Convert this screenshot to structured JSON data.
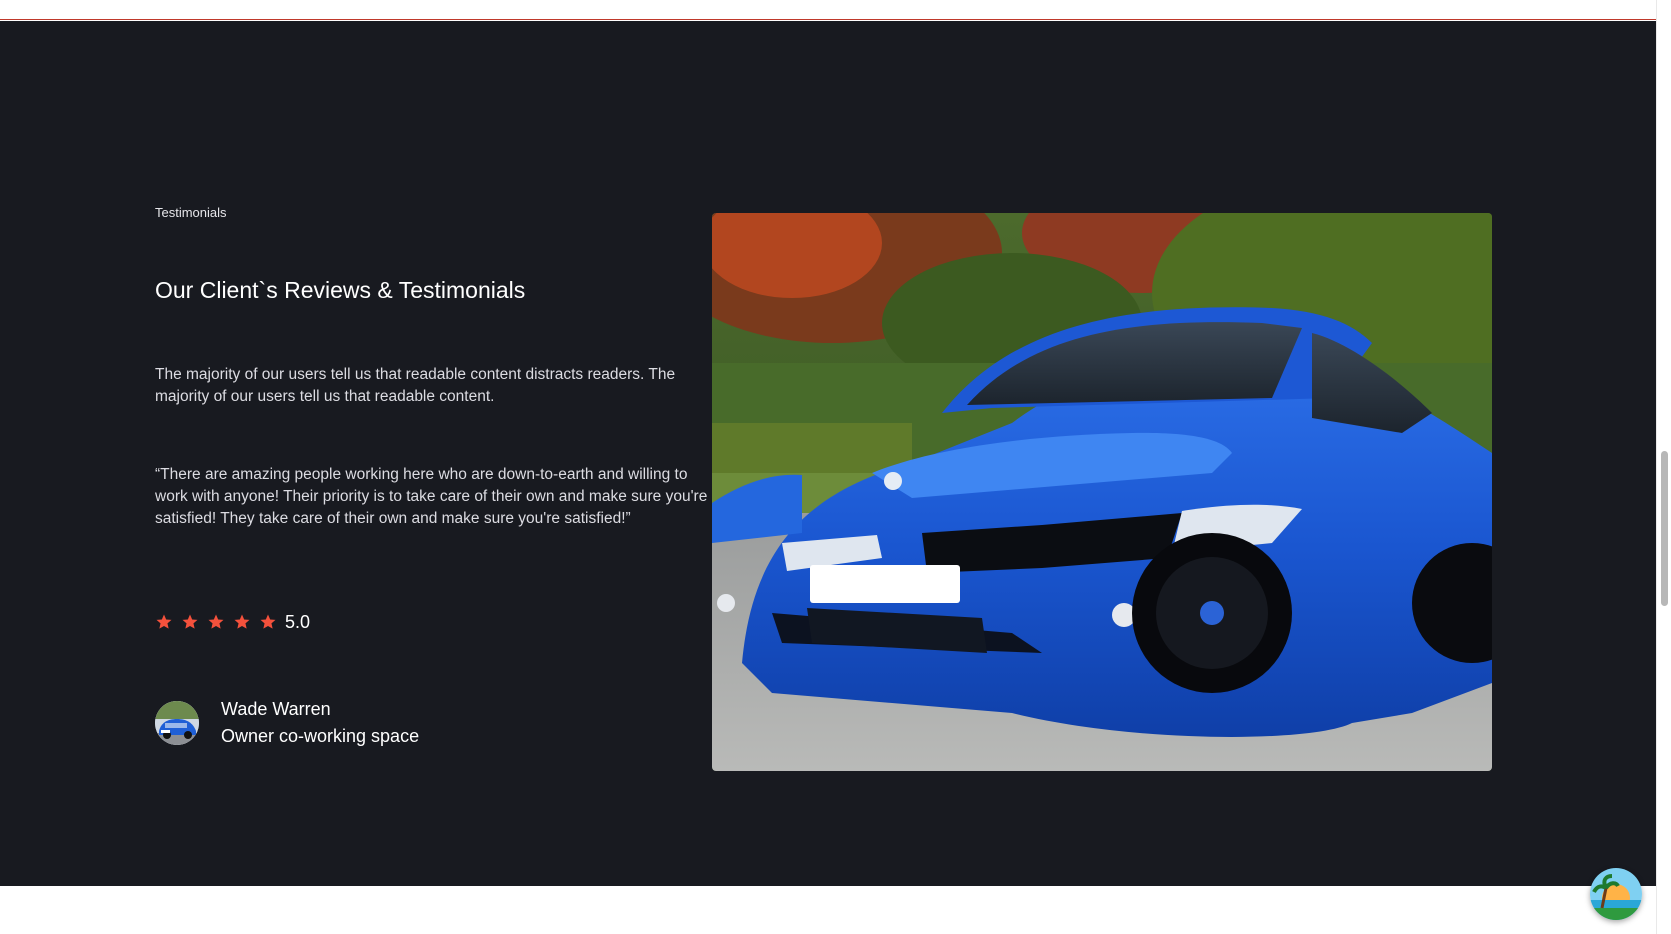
{
  "testimonials": {
    "eyebrow": "Testimonials",
    "title": "Our Client`s Reviews & Testimonials",
    "description": "The majority of our users tell us that readable content distracts readers. The majority of our users tell us that readable content.",
    "quote": "“There are amazing people working here who are down-to-earth and willing to work with anyone! Their priority is to take care of their own and make sure you're satisfied! They take care of their own and make sure you're satisfied!”",
    "rating": {
      "stars": 5,
      "value": "5.0"
    },
    "author": {
      "name": "Wade Warren",
      "role": "Owner co-working space"
    }
  },
  "colors": {
    "section_bg": "#181a20",
    "star": "#f4513c",
    "car": "#1f5fd6"
  },
  "icons": {
    "star": "star-icon",
    "avatar": "avatar",
    "floating_button": "beach-icon"
  }
}
